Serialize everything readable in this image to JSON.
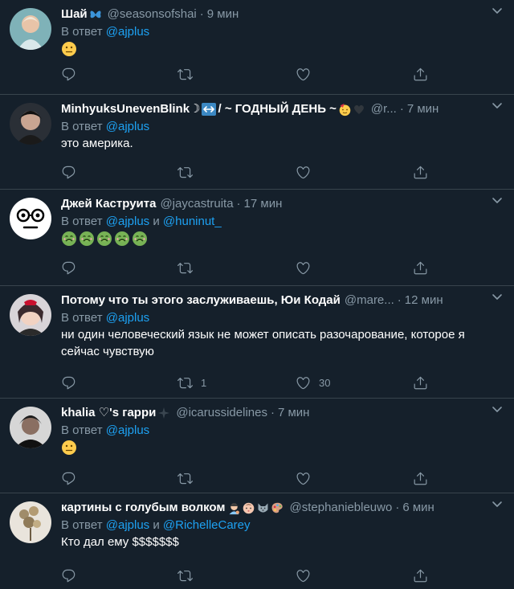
{
  "reply_prefix": "В ответ",
  "and_word": "и",
  "tweets": [
    {
      "name": "Шай",
      "name_emojis": [
        "butterfly-emoji"
      ],
      "handle": "@seasonsofshai",
      "time": "9 мин",
      "mentions": [
        "@ajplus"
      ],
      "text": "",
      "emojis": [
        "neutral-face-emoji"
      ],
      "reply_count": "",
      "retweet_count": "",
      "like_count": ""
    },
    {
      "name": "MinhyuksUnevenBlink☽",
      "name_emojis": [
        "left-right-arrow-emoji"
      ],
      "name_suffix": "/ ~ ГОДНЫЙ ДЕНЬ ~",
      "name_emojis_2": [
        "partying-face-emoji",
        "black-heart-emoji"
      ],
      "handle": "@r...",
      "time": "7 мин",
      "mentions": [
        "@ajplus"
      ],
      "text": "это америка.",
      "emojis": [],
      "reply_count": "",
      "retweet_count": "",
      "like_count": ""
    },
    {
      "name": "Джей Каструита",
      "name_emojis": [],
      "handle": "@jaycastruita",
      "time": "17 мин",
      "mentions": [
        "@ajplus",
        "@huninut_"
      ],
      "text": "",
      "emojis": [
        "nauseated-face-emoji",
        "nauseated-face-emoji",
        "nauseated-face-emoji",
        "nauseated-face-emoji",
        "nauseated-face-emoji"
      ],
      "reply_count": "",
      "retweet_count": "",
      "like_count": ""
    },
    {
      "name": "Потому что ты этого заслуживаешь, Юи Кодай",
      "name_emojis": [],
      "handle": "@mare...",
      "time": "12 мин",
      "mentions": [
        "@ajplus"
      ],
      "text": "ни один человеческий язык не может описать разочарование, которое я сейчас чувствую",
      "emojis": [],
      "reply_count": "",
      "retweet_count": "1",
      "like_count": "30"
    },
    {
      "name": "khalia ♡'s гарри",
      "name_emojis": [
        "sparkle-emoji"
      ],
      "handle": "@icarussidelines",
      "time": "7 мин",
      "mentions": [
        "@ajplus"
      ],
      "text": "",
      "emojis": [
        "neutral-face-emoji"
      ],
      "reply_count": "",
      "retweet_count": "",
      "like_count": ""
    },
    {
      "name": "картины с голубым волком",
      "name_emojis": [
        "artist-emoji",
        "face-emoji",
        "wolf-emoji",
        "palette-emoji"
      ],
      "handle": "@stephaniebleuwo",
      "time": "6 мин",
      "mentions": [
        "@ajplus",
        "@RichelleCarey"
      ],
      "text": "Кто дал ему $$$$$$$",
      "emojis": [],
      "reply_count": "",
      "retweet_count": "",
      "like_count": ""
    }
  ]
}
